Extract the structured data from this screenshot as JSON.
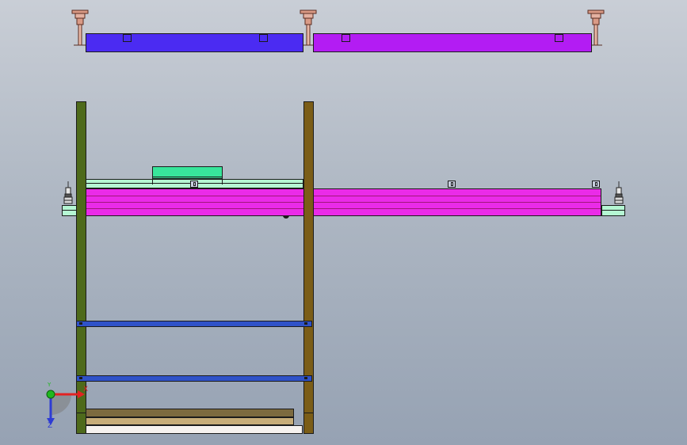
{
  "viewport": {
    "background_top": "#c9ced6",
    "background_bottom": "#96a2b3"
  },
  "colors": {
    "blue_panel": "#4b2bf2",
    "purple_panel": "#b31cf3",
    "magenta_beam": "#ea2be8",
    "mint": "#b5f7d3",
    "green_block": "#38e59b",
    "olive_post": "#4e6a1b",
    "brown_post": "#7b5d17",
    "blue_crossbar": "#2f52c8",
    "base_dark": "#7c6a3f",
    "base_tan": "#c7ad79",
    "base_white": "#f6f2ef",
    "copper_hanger": "#d99a86"
  },
  "icons": {
    "hanger_pins": [
      "suspension-pin-icon",
      "suspension-pin-icon",
      "suspension-pin-icon"
    ],
    "side_clamps": [
      "clamp-icon",
      "clamp-icon"
    ],
    "triad": "coordinate-triad-icon"
  },
  "triad": {
    "x_label": "X",
    "y_label": "Y",
    "z_label": "Z",
    "x_color": "#e32222",
    "y_color": "#1fb81f",
    "z_color": "#2e3cd4"
  }
}
